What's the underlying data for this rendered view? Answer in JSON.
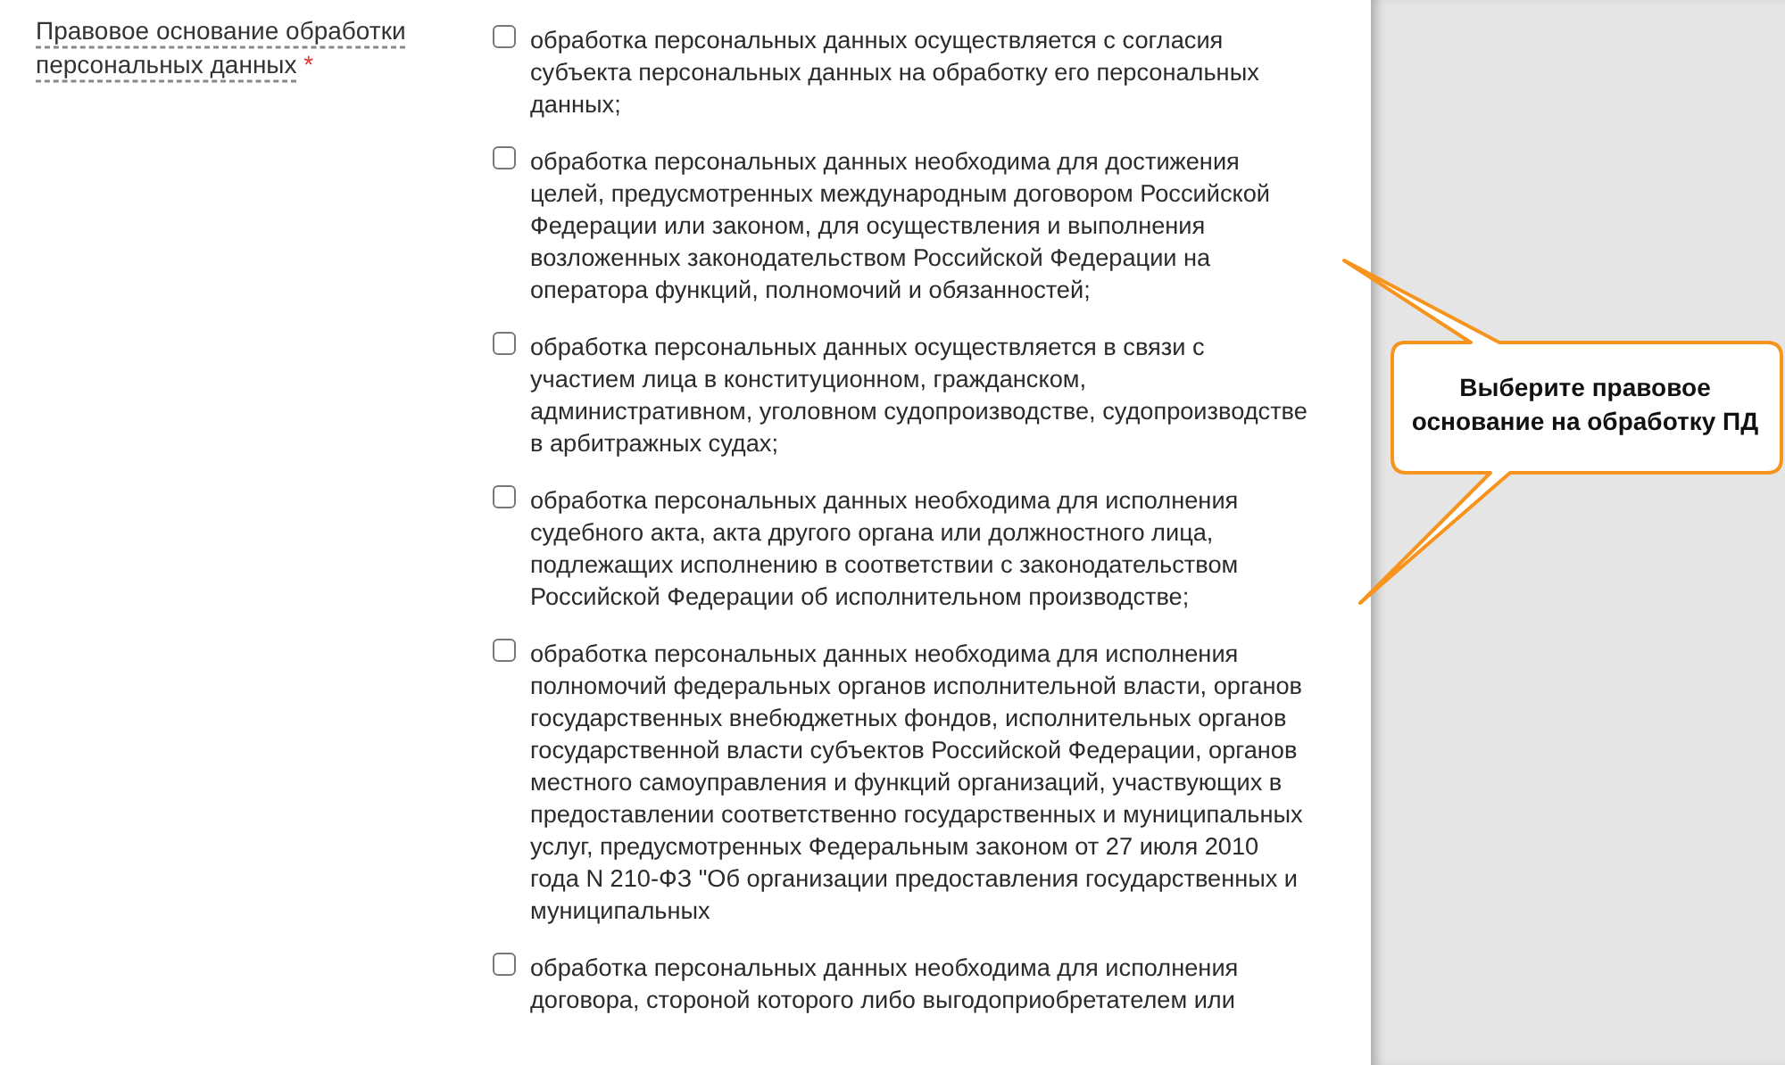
{
  "field": {
    "label": "Правовое основание обработки персональных данных",
    "required_mark": "*"
  },
  "options": [
    {
      "text": "обработка персональных данных осуществляется с согласия субъекта персональных данных на обработку его персональных данных;",
      "checked": false
    },
    {
      "text": "обработка персональных данных необходима для достижения целей, предусмотренных международным договором Российской Федерации или законом, для осуществления и выполнения возложенных законодательством Российской Федерации на оператора функций, полномочий и обязанностей;",
      "checked": false
    },
    {
      "text": "обработка персональных данных осуществляется в связи с участием лица в конституционном, гражданском, административном, уголовном судопроизводстве, судопроизводстве в арбитражных судах;",
      "checked": false
    },
    {
      "text": "обработка персональных данных необходима для исполнения судебного акта, акта другого органа или должностного лица, подлежащих исполнению в соответствии с законодательством Российской Федерации об исполнительном производстве;",
      "checked": false
    },
    {
      "text": "обработка персональных данных необходима для исполнения полномочий федеральных органов исполнительной власти, органов государственных внебюджетных фондов, исполнительных органов государственной власти субъектов Российской Федерации, органов местного самоуправления и функций организаций, участвующих в предоставлении соответственно государственных и муниципальных услуг, предусмотренных Федеральным законом от 27 июля 2010 года N 210-ФЗ \"Об организации предоставления государственных и муниципальных",
      "checked": false
    },
    {
      "text": "обработка персональных данных необходима для исполнения договора, стороной которого либо выгодоприобретателем или",
      "checked": false
    }
  ],
  "callout": {
    "text": "Выберите правовое основание на обработку ПД"
  }
}
